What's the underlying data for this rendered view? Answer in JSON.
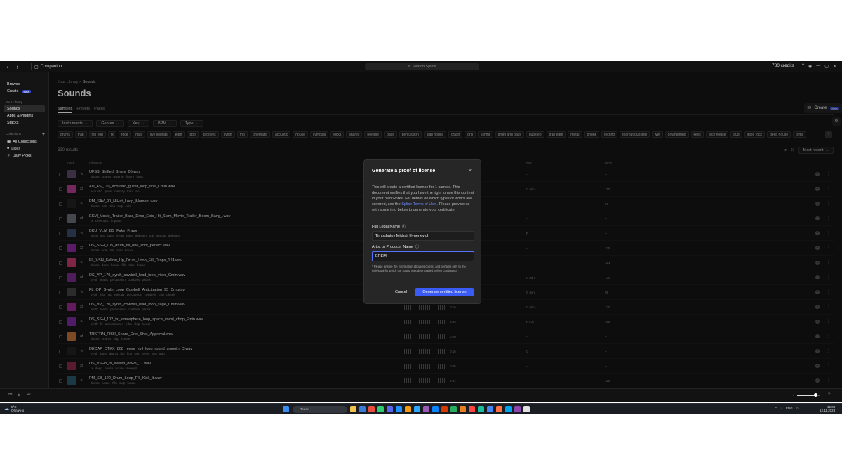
{
  "titlebar": {
    "companion": "Companion",
    "search_placeholder": "Search Splice",
    "credits": "780 credits"
  },
  "sidebar": {
    "browse": "Browse",
    "create": "Create",
    "beta": "Beta",
    "your_library": "Your Library",
    "sounds": "Sounds",
    "apps_plugins": "Apps & Plugins",
    "stacks": "Stacks",
    "collections": "Collections",
    "all_collections": "All Collections",
    "likes": "Likes",
    "daily_picks": "Daily Picks"
  },
  "main": {
    "breadcrumb_root": "Your Library",
    "breadcrumb_sep": ">",
    "breadcrumb_current": "Sounds",
    "title": "Sounds",
    "create_label": "Create",
    "create_beta": "Beta",
    "tabs": [
      "Samples",
      "Presets",
      "Packs"
    ],
    "dropdowns": [
      "Instruments",
      "Genres",
      "Key",
      "BPM",
      "Type"
    ],
    "tags": [
      "drums",
      "trap",
      "hip hop",
      "fx",
      "rock",
      "hats",
      "live sounds",
      "edm",
      "pop",
      "grooves",
      "synth",
      "rnb",
      "cinematic",
      "acoustic",
      "house",
      "cymbals",
      "kicks",
      "snares",
      "reverse",
      "bass",
      "percussion",
      "slap house",
      "crash",
      "drill",
      "kshmr",
      "drum and bass",
      "dubstep",
      "trap edm",
      "metal",
      "phonk",
      "techno",
      "tearout dubstep",
      "wet",
      "downtempo",
      "keys",
      "tech house",
      "808",
      "indie rock",
      "deep house",
      "toms"
    ],
    "results": "320 results",
    "sort": "Most recent",
    "columns": {
      "pack": "Pack",
      "filename": "Filename",
      "key": "Key",
      "bpm": "BPM"
    }
  },
  "rows": [
    {
      "name": "UFSS_Shifted_Snare_05.wav",
      "tags": "drums snares reverse future bass",
      "time": "",
      "key": "--",
      "bpm": "--",
      "color": "#5a4a66"
    },
    {
      "name": "AU_FS_110_acoustic_guitar_loop_fine_Cmin.wav",
      "tags": "acoustic guitar melody trap rnb",
      "time": "",
      "key": "C min",
      "bpm": "110",
      "color": "#b23d8c"
    },
    {
      "name": "PM_SAV_90_HiHat_Loop_Moment.wav",
      "tags": "drums hats trap trap edm",
      "time": "",
      "key": "--",
      "bpm": "90",
      "color": "#222"
    },
    {
      "name": "ESM_Movie_Trailer_Bass_Drop_Epic_Hit_Slam_Movie_Trailer_Boom_Bang_.wav",
      "tags": "fx cinematic impacts",
      "time": "",
      "key": "--",
      "bpm": "--",
      "color": "#6b6e79"
    },
    {
      "name": "BKU_VLM_BS_Fake_F.wav",
      "tags": "drum and bass synth bass dubstep sub tearout dubstep",
      "time": "",
      "key": "F",
      "bpm": "--",
      "color": "#3a4a6a"
    },
    {
      "name": "DS_SSH_105_drum_fill_one_shot_perfect.wav",
      "tags": "drums edm fills slap house",
      "time": "",
      "key": "--",
      "bpm": "105",
      "color": "#8a2aa0"
    },
    {
      "name": "FL_VSH_Follow_Up_Drum_Loop_Fill_Drops_124.wav",
      "tags": "drums deep house fills slap house",
      "time": "",
      "key": "--",
      "bpm": "124",
      "color": "#c43a6a"
    },
    {
      "name": "DS_VP_170_synth_cowbell_lead_loop_viper_Cmin.wav",
      "tags": "synth leads percussion cowbells phonk",
      "time": "",
      "key": "C min",
      "bpm": "170",
      "color": "#7a2b8e"
    },
    {
      "name": "FL_OP_Synth_Loop_Cowbell_Anticipation_95_Cm.wav",
      "tags": "synth hip hop melody percussion cowbells trap phonk",
      "time": "",
      "key": "C min",
      "bpm": "95",
      "color": "#444"
    },
    {
      "name": "DS_VP_120_synth_cowbell_lead_loop_sage_Cmin.wav",
      "tags": "synth leads percussion cowbells phonk",
      "time": "0:16",
      "key": "C min",
      "bpm": "120",
      "color": "#9a2a90"
    },
    {
      "name": "DS_SSH_102_fx_atmosphere_loop_space_vocal_chop_Fmin.wav",
      "tags": "synth fx atmospheres edm slap house",
      "time": "0:05",
      "key": "F min",
      "bpm": "102",
      "color": "#7a2b9e"
    },
    {
      "name": "TRKTRN_FISH_Snare_One_Shot_Approval.wav",
      "tags": "drums snares slap house",
      "time": "0:00",
      "key": "--",
      "bpm": "--",
      "color": "#c2703a"
    },
    {
      "name": "DECAP_DTKX_808_reese_evil_long_round_smooth_C.wav",
      "tags": "synth bass drums hip hop wet reese 808 trap",
      "time": "0:16",
      "key": "C",
      "bpm": "--",
      "color": "#222"
    },
    {
      "name": "DS_VSH3_fx_sweep_down_17.wav",
      "tags": "fx deep house house sweeps",
      "time": "0:05",
      "key": "--",
      "bpm": "--",
      "color": "#8a2a4a"
    },
    {
      "name": "PM_SB_122_Drum_Loop_Fill_Kick_It.wav",
      "tags": "drums house fills slap house",
      "time": "0:01",
      "key": "--",
      "bpm": "122",
      "color": "#2a5a6a"
    }
  ],
  "modal": {
    "title": "Generate a proof of license",
    "close": "×",
    "intro_1": "This will create a certified license for 1 sample. This document verifies that you have the right to use this content in your own works. For details on which types of works are covered, see the ",
    "intro_link": "Splice Terms of Use",
    "intro_2": " . Please provide us with some info below to generate your certificate.",
    "full_name_label": "Full Legal Name",
    "full_name_value": "Timoshatov Mikhail Evgenevich",
    "artist_label": "Artist or Producer Name",
    "artist_value": "EREM",
    "note": "* Please ensure the information above is correct and pertains only to the individual for which the sound was downloaded before continuing.",
    "cancel": "Cancel",
    "generate": "Generate certified license"
  },
  "player": {
    "volume_level": 0.8
  },
  "taskbar": {
    "temp": "5°C",
    "weather": "Облачно",
    "search": "Поиск",
    "lang": "ENG",
    "time": "16:08",
    "date": "12.11.2023"
  }
}
